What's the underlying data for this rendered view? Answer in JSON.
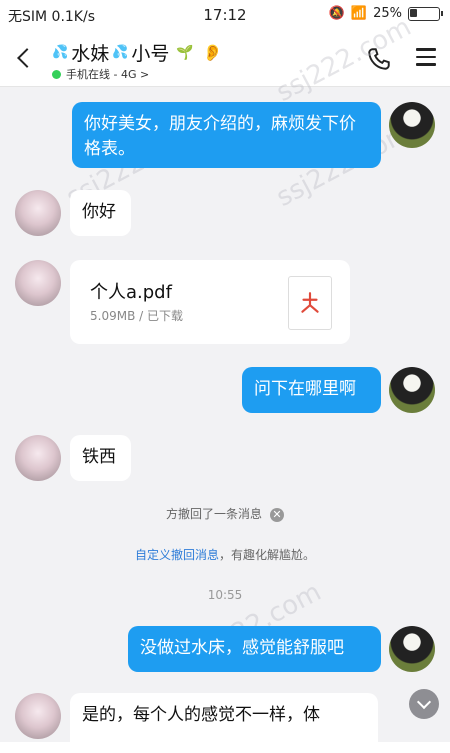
{
  "status_bar": {
    "carrier": "无SIM 0.1K/s",
    "time": "17:12",
    "battery": "25%"
  },
  "header": {
    "title_part1": "水妹",
    "title_part2": "小号",
    "online_status": "手机在线 - 4G >"
  },
  "messages": {
    "m1_text": "你好美女，朋友介绍的，麻烦发下价格表。",
    "m2_text": "你好",
    "file_name": "个人a.pdf",
    "file_meta": "5.09MB / 已下载",
    "m3_text": "问下在哪里啊",
    "m4_text": "铁西",
    "m5_text": "没做过水床，感觉能舒服吧",
    "m6_text": "是的，每个人的感觉不一样，体"
  },
  "system": {
    "recall_text": "方撤回了一条消息",
    "custom_link": "自定义撤回消息",
    "custom_suffix": "，有趣化解尴尬。",
    "time_label": "10:55"
  },
  "watermark": "ssj222.com",
  "colors": {
    "my_bubble": "#1e9df1",
    "online_dot": "#35d05a",
    "link": "#2f7dd8"
  },
  "icons": [
    "back-icon",
    "water-drop-icon",
    "leaf-icon",
    "ear-icon",
    "phone-icon",
    "menu-icon",
    "pdf-icon",
    "close-icon",
    "chevron-down-icon"
  ]
}
